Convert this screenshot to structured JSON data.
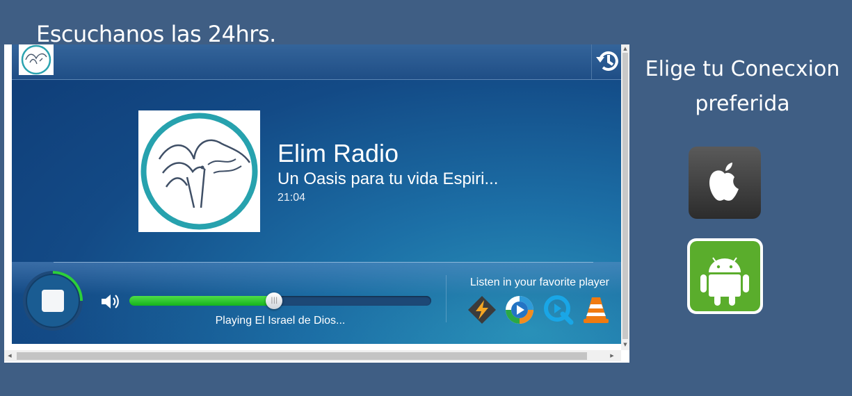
{
  "page": {
    "heading": "Escuchanos las 24hrs."
  },
  "player": {
    "station_name": "Elim Radio",
    "track_title": "Un Oasis para tu vida Espiri...",
    "time": "21:04",
    "status": "Playing El Israel de Dios...",
    "volume_fraction": 0.48,
    "favorite_player_label": "Listen in your favorite player",
    "players": [
      "winamp-icon",
      "windows-media-player-icon",
      "quicktime-icon",
      "vlc-icon"
    ],
    "colors": {
      "volume_fill": "#22c12a",
      "background": "#134a86"
    }
  },
  "sidebar": {
    "title": "Elige tu Conecxion preferida",
    "apple_color": "#3a3a3a",
    "android_color": "#5aad2c"
  }
}
